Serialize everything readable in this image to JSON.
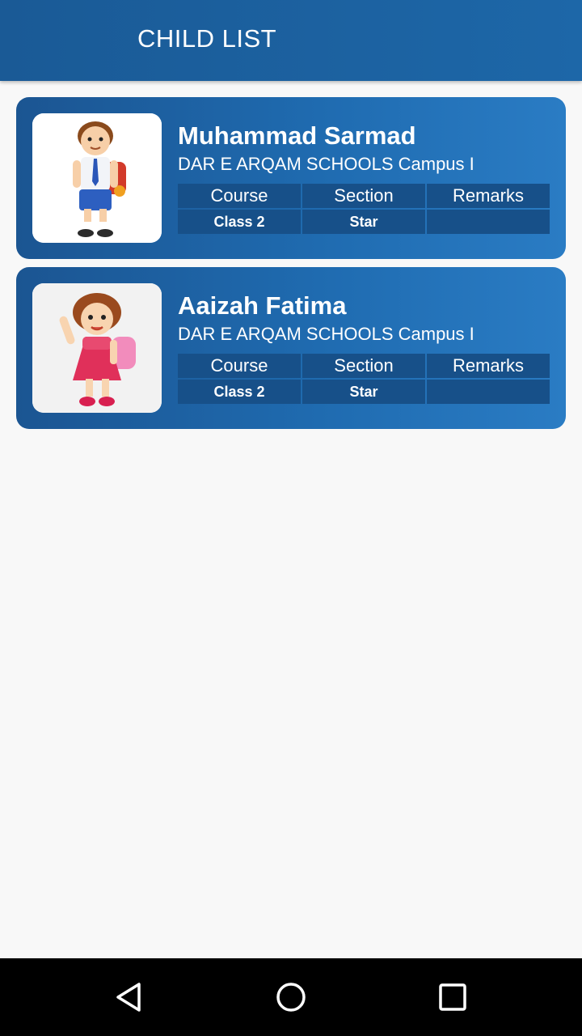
{
  "app_bar": {
    "title": "CHILD LIST"
  },
  "table_headers": {
    "course": "Course",
    "section": "Section",
    "remarks": "Remarks"
  },
  "children": [
    {
      "name": "Muhammad Sarmad",
      "school": "DAR E ARQAM SCHOOLS Campus I",
      "course": "Class 2",
      "section": "Star",
      "remarks": "",
      "avatar_icon": "boy-avatar-icon"
    },
    {
      "name": "Aaizah Fatima",
      "school": "DAR E ARQAM SCHOOLS Campus I",
      "course": "Class 2",
      "section": "Star",
      "remarks": "",
      "avatar_icon": "girl-avatar-icon"
    }
  ],
  "nav": {
    "back": "back-icon",
    "home": "home-icon",
    "recents": "recents-icon"
  },
  "colors": {
    "app_bar": "#1a5a96",
    "card": "#1f6bb0",
    "table_cell": "#175089",
    "background": "#f8f8f8"
  }
}
